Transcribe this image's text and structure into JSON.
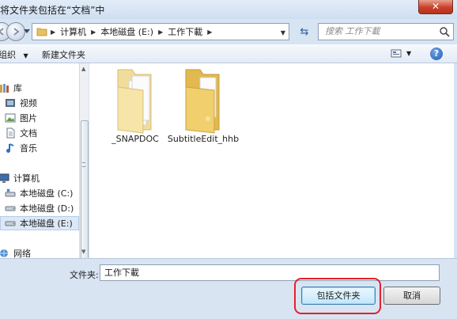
{
  "window": {
    "title": "将文件夹包括在“文档”中",
    "close_label": "✕"
  },
  "navigation": {
    "breadcrumbs": [
      "计算机",
      "本地磁盘 (E:)",
      "工作下載"
    ],
    "search_placeholder": "搜索 工作下載"
  },
  "toolbar": {
    "organize_label": "组织",
    "new_folder_label": "新建文件夹",
    "help_label": "?"
  },
  "nav_pane": {
    "items": [
      {
        "label": "库",
        "icon": "library-icon"
      },
      {
        "label": "视频",
        "icon": "video-icon"
      },
      {
        "label": "图片",
        "icon": "picture-icon"
      },
      {
        "label": "文档",
        "icon": "document-icon"
      },
      {
        "label": "音乐",
        "icon": "music-icon"
      },
      {
        "label": "计算机",
        "icon": "computer-icon"
      },
      {
        "label": "本地磁盘 (C:)",
        "icon": "drive-icon"
      },
      {
        "label": "本地磁盘 (D:)",
        "icon": "drive-icon"
      },
      {
        "label": "本地磁盘 (E:)",
        "icon": "drive-icon"
      },
      {
        "label": "网络",
        "icon": "network-icon"
      }
    ]
  },
  "files": [
    {
      "name": "_SNAPDOC",
      "icon": "folder-icon"
    },
    {
      "name": "SubtitleEdit_hhb",
      "icon": "folder-icon"
    }
  ],
  "footer": {
    "folder_label": "文件夹:",
    "folder_value": "工作下載",
    "include_button": "包括文件夹",
    "cancel_button": "取消"
  },
  "colors": {
    "highlight": "#e3212a",
    "accent": "#3c7fb1"
  }
}
